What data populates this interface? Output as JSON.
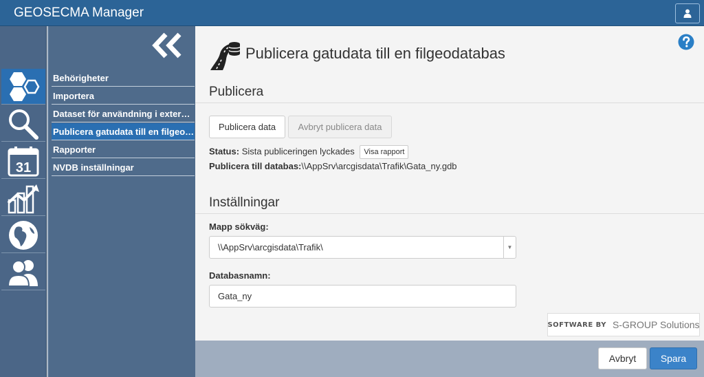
{
  "app": {
    "title": "GEOSECMA Manager",
    "user_icon": "user-icon",
    "colors": {
      "header": "#2c6497",
      "sidebar": "#4f6b8b",
      "active": "#2a6fb2",
      "primary_button": "#3b83c9"
    }
  },
  "iconbar": {
    "items": [
      {
        "icon": "hexagons-icon",
        "active": true
      },
      {
        "icon": "search-icon",
        "active": false
      },
      {
        "icon": "calendar-icon",
        "label": "31",
        "active": false
      },
      {
        "icon": "chart-icon",
        "active": false
      },
      {
        "icon": "globe-icon",
        "active": false
      },
      {
        "icon": "users-icon",
        "active": false
      }
    ]
  },
  "nav": {
    "collapse_icon": "double-chevron-left-icon",
    "items": [
      {
        "label": "Behörigheter",
        "active": false
      },
      {
        "label": "Importera",
        "active": false
      },
      {
        "label": "Dataset för användning i externa system",
        "active": false
      },
      {
        "label": "Publicera gatudata till en filgeodatabas",
        "active": true
      },
      {
        "label": "Rapporter",
        "active": false
      },
      {
        "label": "NVDB inställningar",
        "active": false
      }
    ]
  },
  "page": {
    "title": "Publicera gatudata till en filgeodatabas",
    "icon": "road-database-icon",
    "help_icon": "help-icon"
  },
  "publish": {
    "heading": "Publicera",
    "publish_button": "Publicera data",
    "cancel_publish_button": "Avbryt publicera data",
    "status_label": "Status:",
    "status_value": "Sista publiceringen lyckades",
    "report_button": "Visa rapport",
    "target_label": "Publicera till databas:",
    "target_value": "\\\\AppSrv\\arcgisdata\\Trafik\\Gata_ny.gdb"
  },
  "settings": {
    "heading": "Inställningar",
    "folder_label": "Mapp sökväg:",
    "folder_value": "\\\\AppSrv\\arcgisdata\\Trafik\\",
    "dbname_label": "Databasnamn:",
    "dbname_value": "Gata_ny"
  },
  "branding": {
    "prefix": "SOFTWARE BY",
    "company": "S-GROUP Solutions"
  },
  "footer": {
    "cancel": "Avbryt",
    "save": "Spara"
  }
}
